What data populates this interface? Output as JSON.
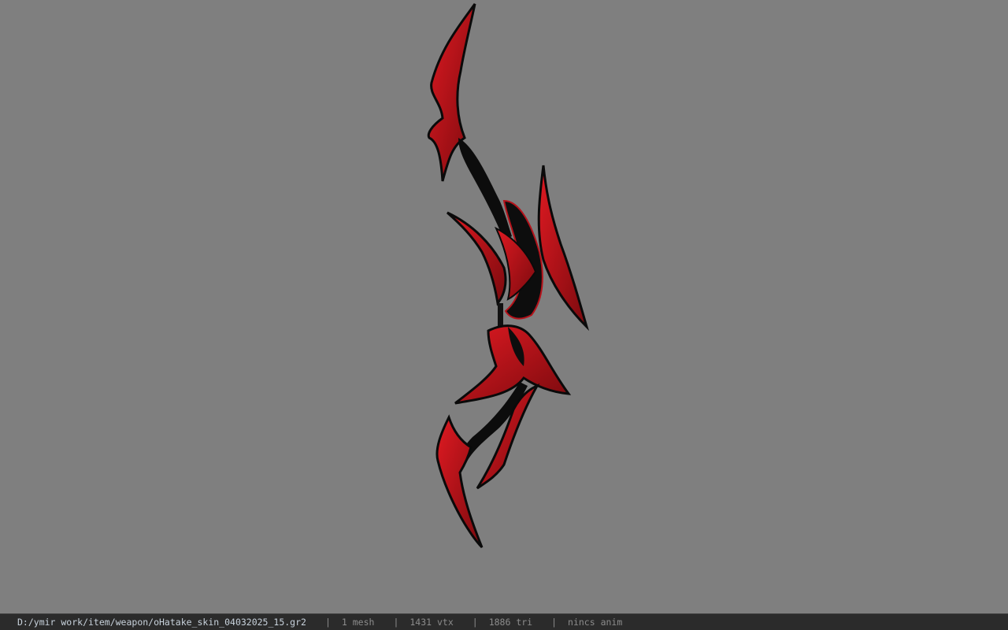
{
  "viewport": {
    "background_color": "#7f7f7f",
    "model": {
      "name": "bow-model",
      "primary_color": "#c8141c",
      "edge_color": "#0a0a0a"
    }
  },
  "statusbar": {
    "file_path": "D:/ymir work/item/weapon/oHatake_skin_04032025_15.gr2",
    "separator": "|",
    "mesh": "1 mesh",
    "vtx": "1431 vtx",
    "tri": "1886 tri",
    "anim": "nincs anim"
  }
}
